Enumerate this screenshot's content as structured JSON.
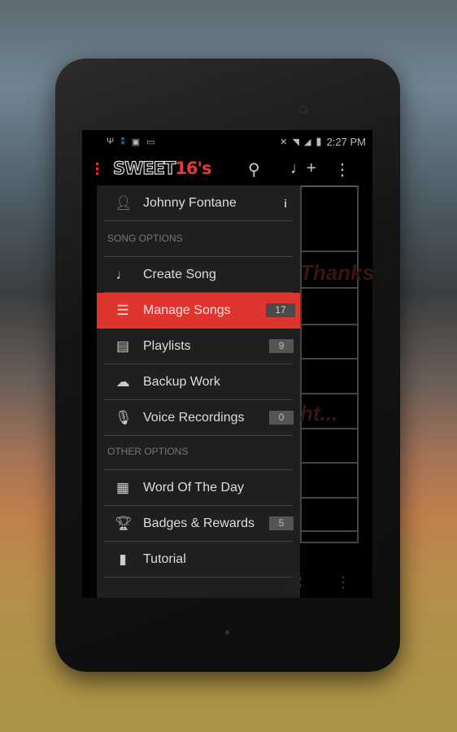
{
  "status_bar": {
    "time": "2:27 PM",
    "left_icons": [
      "usb-icon",
      "debug-icon",
      "image-icon",
      "voicemail-icon"
    ],
    "right_icons": [
      "mute-icon",
      "wifi-icon",
      "4g-icon",
      "signal-icon",
      "battery-charging-icon"
    ]
  },
  "action_bar": {
    "logo_part1": "SWEET",
    "logo_part2": "16's",
    "icons": [
      "search-icon",
      "add-song-icon",
      "overflow-menu-icon"
    ]
  },
  "background_content": {
    "ghost_texts": [
      "Thanksgi...",
      "ht..."
    ]
  },
  "drawer": {
    "user": {
      "name": "Johnny Fontane",
      "info_icon": "info-icon"
    },
    "sections": [
      {
        "title": "SONG OPTIONS",
        "items": [
          {
            "label": "Create Song",
            "icon": "add-song-icon",
            "badge": null,
            "active": false
          },
          {
            "label": "Manage Songs",
            "icon": "song-list-icon",
            "badge": "17",
            "active": true
          },
          {
            "label": "Playlists",
            "icon": "playlist-icon",
            "badge": "9",
            "active": false
          },
          {
            "label": "Backup Work",
            "icon": "backup-icon",
            "badge": null,
            "active": false
          },
          {
            "label": "Voice Recordings",
            "icon": "microphone-icon",
            "badge": "0",
            "active": false
          }
        ]
      },
      {
        "title": "OTHER OPTIONS",
        "items": [
          {
            "label": "Word Of The Day",
            "icon": "calendar-icon",
            "badge": null,
            "active": false
          },
          {
            "label": "Badges & Rewards",
            "icon": "trophy-icon",
            "badge": "5",
            "active": false
          },
          {
            "label": "Tutorial",
            "icon": "book-icon",
            "badge": null,
            "active": false
          }
        ]
      }
    ]
  },
  "colors": {
    "accent": "#e0352f",
    "drawer_bg": "#202020"
  }
}
